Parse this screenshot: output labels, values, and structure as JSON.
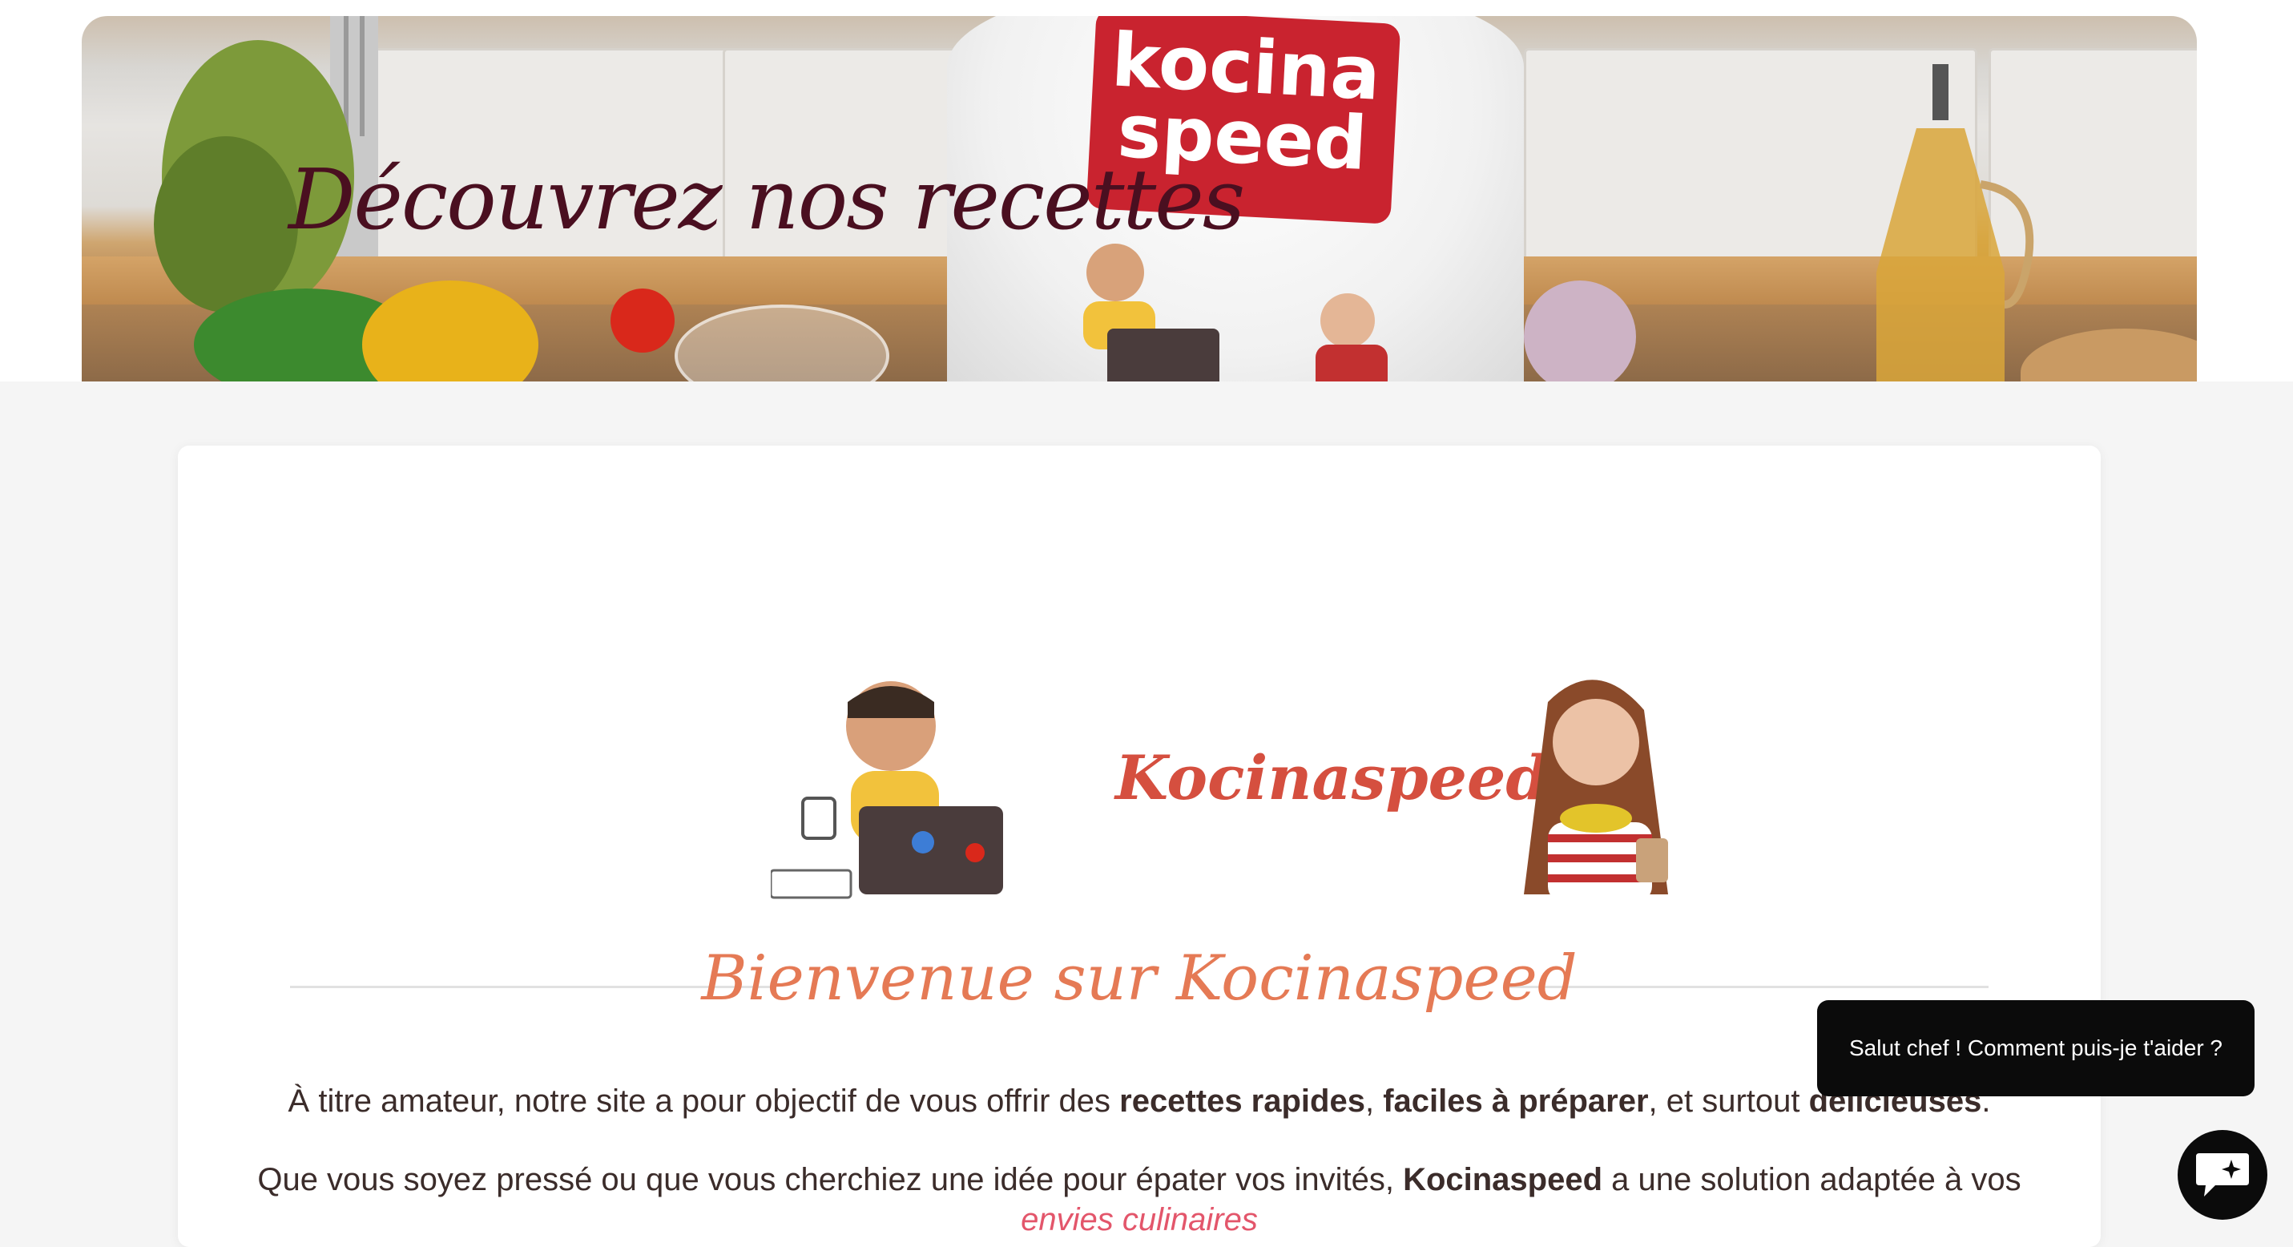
{
  "hero": {
    "title": "Découvrez nos recettes",
    "logo_line1": "kocina",
    "logo_line2": "speed"
  },
  "logo": {
    "brand": "Kocinaspeed"
  },
  "welcome": {
    "title": "Bienvenue sur Kocinaspeed"
  },
  "intro": {
    "p1_a": "À titre amateur, notre site a pour objectif de vous offrir des ",
    "p1_b": "recettes rapides",
    "p1_c": ", ",
    "p1_d": "faciles à préparer",
    "p1_e": ", et surtout ",
    "p1_f": "délicieuses",
    "p1_g": ".",
    "p2_a": "Que vous soyez pressé ou que vous cherchiez une idée pour épater vos invités, ",
    "p2_b": "Kocinaspeed",
    "p2_c": " a une solution adaptée à vos",
    "p3_link": "envies culinaires"
  },
  "chat": {
    "message": "Salut chef ! Comment puis-je t'aider ?",
    "button_icon": "chat-sparkle-icon"
  },
  "colors": {
    "hero_title": "#4a0f20",
    "brand_red": "#d54f3f",
    "welcome_orange": "#e57a55",
    "link_pink": "#e3566b",
    "chat_bg": "#0b0b0b"
  }
}
